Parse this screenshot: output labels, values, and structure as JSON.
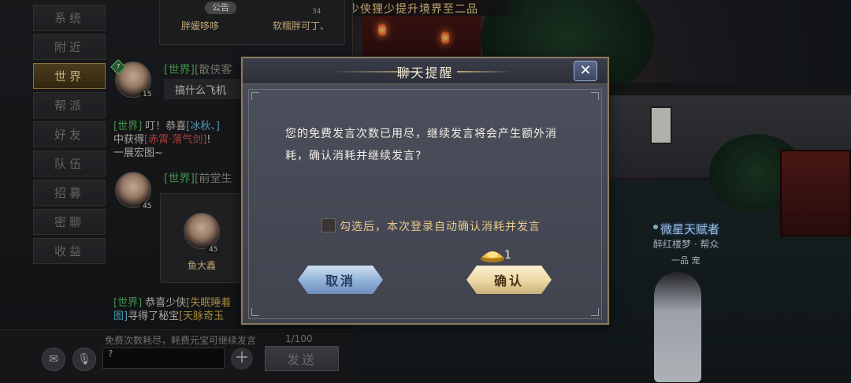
{
  "announcement": "恭喜少侠狸少提升境界至二品",
  "chat_tabs": [
    {
      "label": "系统",
      "active": false
    },
    {
      "label": "附近",
      "active": false
    },
    {
      "label": "世界",
      "active": true
    },
    {
      "label": "帮派",
      "active": false
    },
    {
      "label": "好友",
      "active": false
    },
    {
      "label": "队伍",
      "active": false
    },
    {
      "label": "招募",
      "active": false
    },
    {
      "label": "密聊",
      "active": false
    },
    {
      "label": "收益",
      "active": false
    }
  ],
  "top_card": {
    "tag": "公告",
    "name_left": "胖媛哆哆",
    "name_right": "软糯胖可丁、",
    "level": "34"
  },
  "messages": {
    "m1": {
      "channel": "[世界]",
      "name": "[散侠客",
      "level": "15",
      "badge": "7",
      "text": "搞什么飞机"
    },
    "m2": {
      "line1_channel": "[世界]",
      "line1_text": " 叮！恭喜",
      "line1_name": "[冰秋、]",
      "line2_prefix": "中获得",
      "line2_item": "[赤霄·落气剑]",
      "line2_suffix": "!",
      "line3": "一展宏图~"
    },
    "m3": {
      "channel": "[世界]",
      "name": "[前堂生",
      "level": "45",
      "card_level": "45",
      "card_name": "鱼大鑫"
    },
    "m4": {
      "line1_channel": "[世界]",
      "line1_text": " 恭喜少侠",
      "line1_name": "[失眠睡着",
      "line2_prefix": "图]",
      "line2_text": "寻得了秘宝",
      "line2_item": "[天脉奇玉"
    }
  },
  "input": {
    "hint": "免费次数耗尽，耗费元宝可继续发言",
    "counter": "1/100",
    "value": "?",
    "send_label": "发送"
  },
  "npc": {
    "title": "微星天赋者",
    "guild": "醉红楼梦 · 帮众",
    "name": "一品  宠"
  },
  "dialog": {
    "title": "聊天提醒",
    "message": "您的免费发言次数已用尽，继续发言将会产生额外消耗，确认消耗并继续发言?",
    "checkbox_label": "勾选后，本次登录自动确认消耗并发言",
    "checkbox_checked": false,
    "cost_icon": "gold-ingot-icon",
    "cost_value": "1",
    "cancel_label": "取消",
    "confirm_label": "确认"
  },
  "colors": {
    "gold_text": "#e8c98a",
    "channel_green": "#4fb35c",
    "player_blue": "#5fb8d8",
    "item_red": "#d84848"
  }
}
